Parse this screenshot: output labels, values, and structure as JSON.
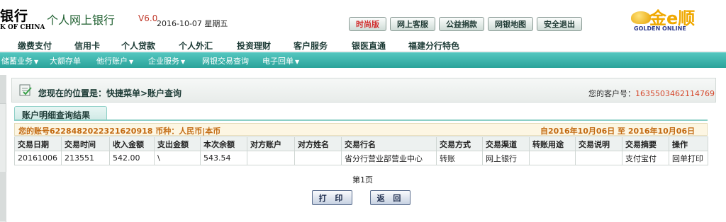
{
  "header": {
    "bank_name_cn": "银行",
    "bank_name_en": "K OF CHINA",
    "app_title": "个人网上银行",
    "app_version": "V6.0",
    "date": "2016-10-07 星期五",
    "buttons": [
      "时尚版",
      "网上客服",
      "公益捐款",
      "网银地图",
      "安全退出"
    ],
    "brand_cn": "金e顺",
    "brand_en": "GOLDEN ONLINE"
  },
  "mainnav": [
    "缴费支付",
    "信用卡",
    "个人贷款",
    "个人外汇",
    "投资理财",
    "客户服务",
    "银医直通",
    "福建分行特色"
  ],
  "subnav": [
    "储蓄业务",
    "大额存单",
    "他行账户",
    "企业服务",
    "网银交易查询",
    "电子回单"
  ],
  "location": {
    "text": "您现在的位置是：快捷菜单>账户查询",
    "customer_label": "您的客户号：",
    "customer_no": "1635503462114769"
  },
  "tab": {
    "label": "账户明细查询结果"
  },
  "account": {
    "info": "您的账号6228482022321620918 币种：人民币|本币",
    "range": "自2016年10月06日  至  2016年10月06日"
  },
  "table": {
    "headers": [
      "交易日期",
      "交易时间",
      "收入金额",
      "支出金额",
      "本次余额",
      "对方账户",
      "对方姓名",
      "交易行名",
      "交易方式",
      "交易渠道",
      "转账用途",
      "交易说明",
      "交易摘要",
      "操作"
    ],
    "rows": [
      [
        "20161006",
        "213551",
        "542.00",
        "\\",
        "543.54",
        "",
        "",
        "省分行营业部营业中心",
        "转账",
        "网上银行",
        "",
        "",
        "支付宝付",
        "回单打印"
      ]
    ]
  },
  "pagination": {
    "label": "第1页"
  },
  "actions": {
    "print": "打 印",
    "back": "返 回"
  }
}
